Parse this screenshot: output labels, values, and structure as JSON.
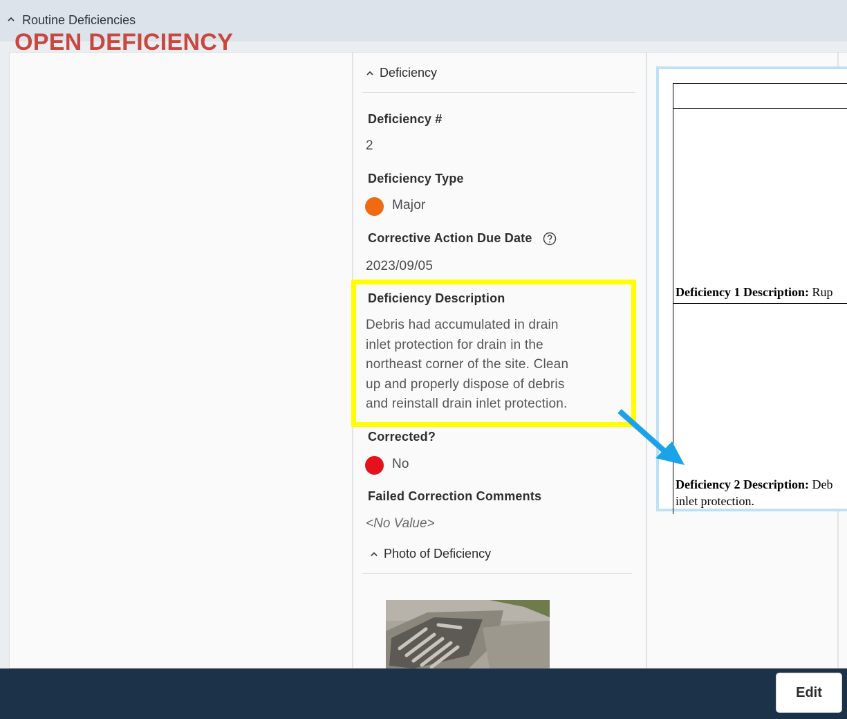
{
  "header": {
    "section_title": "Routine Deficiencies"
  },
  "main": {
    "status_title": "OPEN DEFICIENCY",
    "status_color": "#c8483f"
  },
  "deficiency": {
    "section_title": "Deficiency",
    "number_label": "Deficiency #",
    "number_value": "2",
    "type_label": "Deficiency Type",
    "type_value": "Major",
    "type_color": "#f06a12",
    "due_date_label": "Corrective Action Due Date",
    "due_date_value": "2023/09/05",
    "description_label": "Deficiency Description",
    "description_lines": [
      "Debris had accumulated in drain",
      "inlet protection for drain in the",
      "northeast corner of the site. Clean",
      "up and properly dispose of debris",
      "and reinstall drain inlet protection."
    ],
    "corrected_label": "Corrected?",
    "corrected_value": "No",
    "corrected_color": "#e3121c",
    "failed_comments_label": "Failed Correction Comments",
    "failed_comments_value": "<No Value>",
    "photo_section_title": "Photo of Deficiency"
  },
  "document_preview": {
    "line1_bold": "Deficiency 1 Description:",
    "line1_rest": " Rup",
    "line2_bold": "Deficiency 2 Description:",
    "line2_rest": " Deb",
    "line3": "inlet protection."
  },
  "annotations": {
    "highlight_color": "#ffff00",
    "arrow_color": "#1aa3e8"
  },
  "footer": {
    "edit_label": "Edit"
  }
}
